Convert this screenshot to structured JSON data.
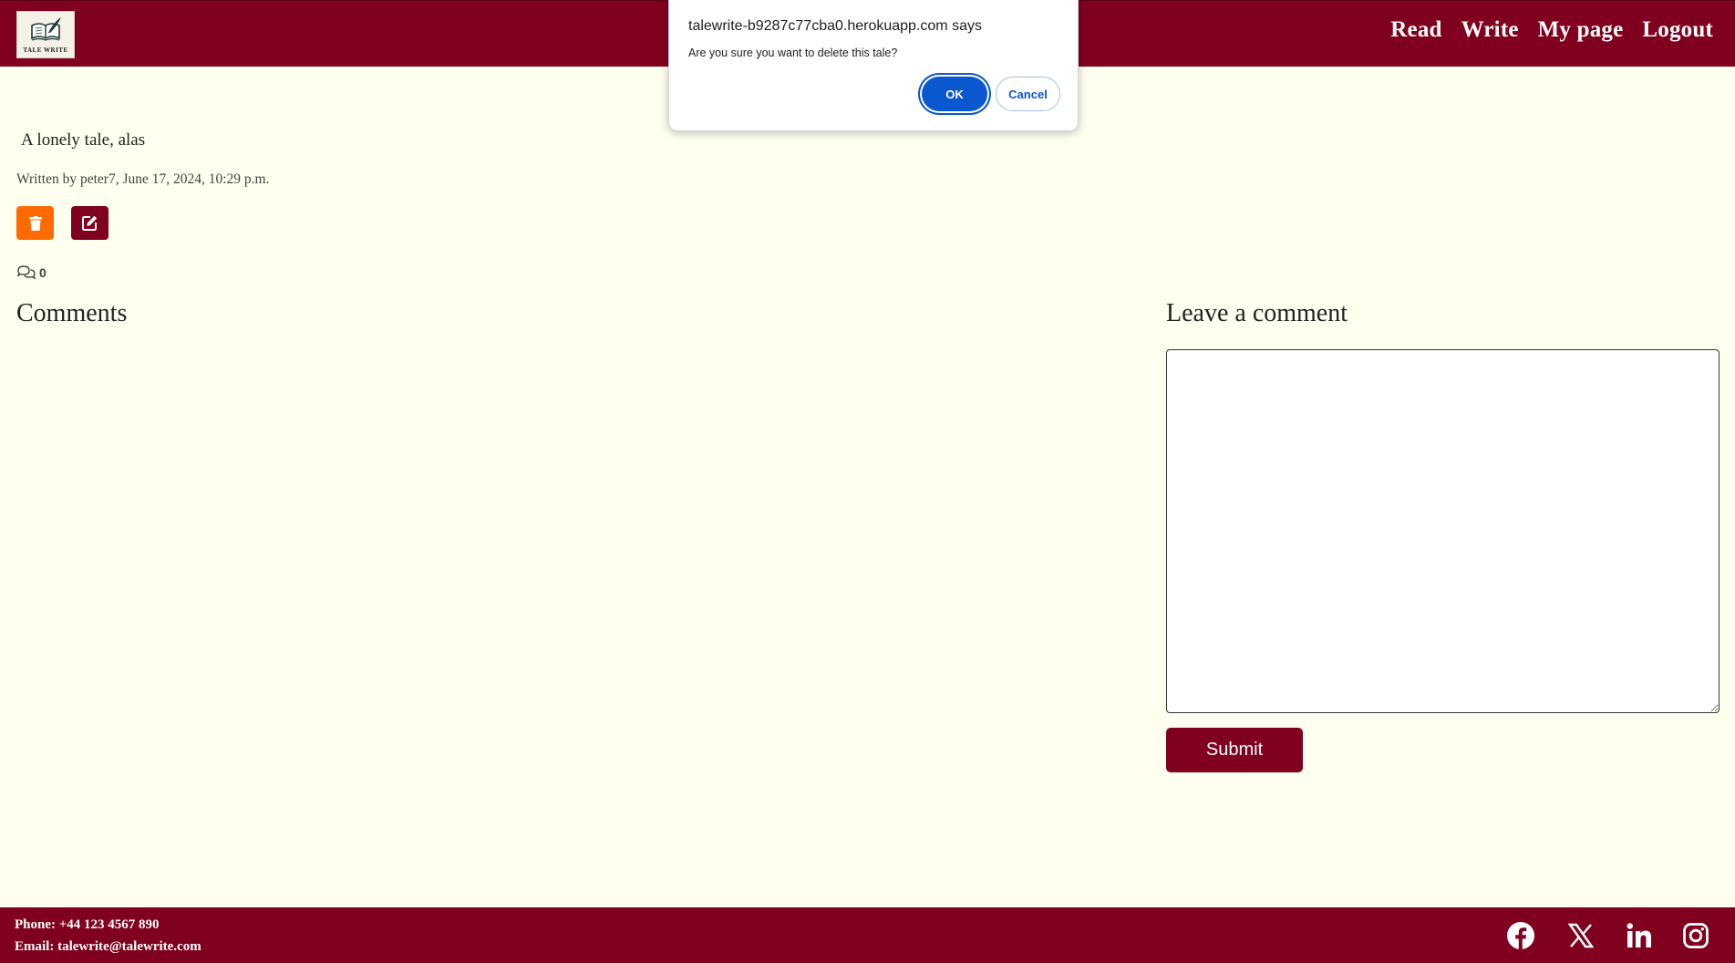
{
  "header": {
    "logo_text": "TALE WRITE",
    "nav": [
      "Read",
      "Write",
      "My page",
      "Logout"
    ]
  },
  "dialog": {
    "title": "talewrite-b9287c77cba0.herokuapp.com says",
    "message": "Are you sure you want to delete this tale?",
    "ok_label": "OK",
    "cancel_label": "Cancel"
  },
  "tale": {
    "title": "A lonely tale, alas",
    "meta": "Written by peter7, June 17, 2024, 10:29 p.m.",
    "comment_count": "0"
  },
  "comments": {
    "heading": "Comments",
    "leave_heading": "Leave a comment",
    "submit_label": "Submit",
    "textarea_value": ""
  },
  "footer": {
    "phone": "Phone: +44 123 4567 890",
    "email": "Email: talewrite@talewrite.com",
    "social_icons": [
      "facebook-icon",
      "x-icon",
      "linkedin-icon",
      "instagram-icon"
    ]
  },
  "colors": {
    "brand": "#80001f",
    "background": "#fffff0",
    "delete": "#ff6a00",
    "dialog_ok": "#0b57d0"
  }
}
